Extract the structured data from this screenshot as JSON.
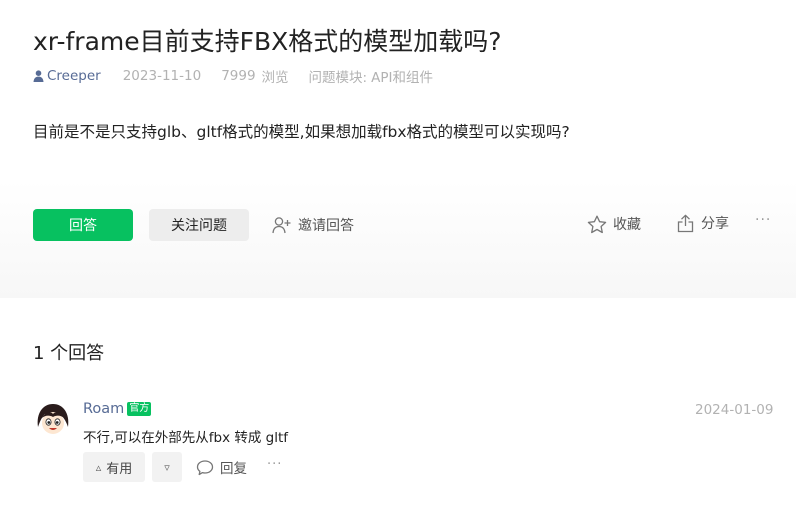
{
  "question": {
    "title": "xr-frame目前支持FBX格式的模型加载吗?",
    "author": "Creeper",
    "date": "2023-11-10",
    "views": "7999",
    "views_label": "浏览",
    "module_label": "问题模块:",
    "module": "API和组件",
    "body": "目前是不是只支持glb、gltf格式的模型,如果想加载fbx格式的模型可以实现吗?"
  },
  "actions": {
    "answer_label": "回答",
    "follow_label": "关注问题",
    "invite_label": "邀请回答",
    "favorite_label": "收藏",
    "share_label": "分享",
    "more_label": "···"
  },
  "answers": {
    "count_label": "1 个回答",
    "items": [
      {
        "author": "Roam",
        "badge": "官方",
        "date": "2024-01-09",
        "text": "不行,可以在外部先从fbx 转成 gltf",
        "useful_icon": "▵",
        "useful_label": "有用",
        "down_icon": "▿",
        "reply_label": "回复",
        "more_label": "···"
      }
    ]
  },
  "colors": {
    "accent_green": "#07c160",
    "link_blue": "#576b95",
    "muted": "#b2b2b2"
  }
}
